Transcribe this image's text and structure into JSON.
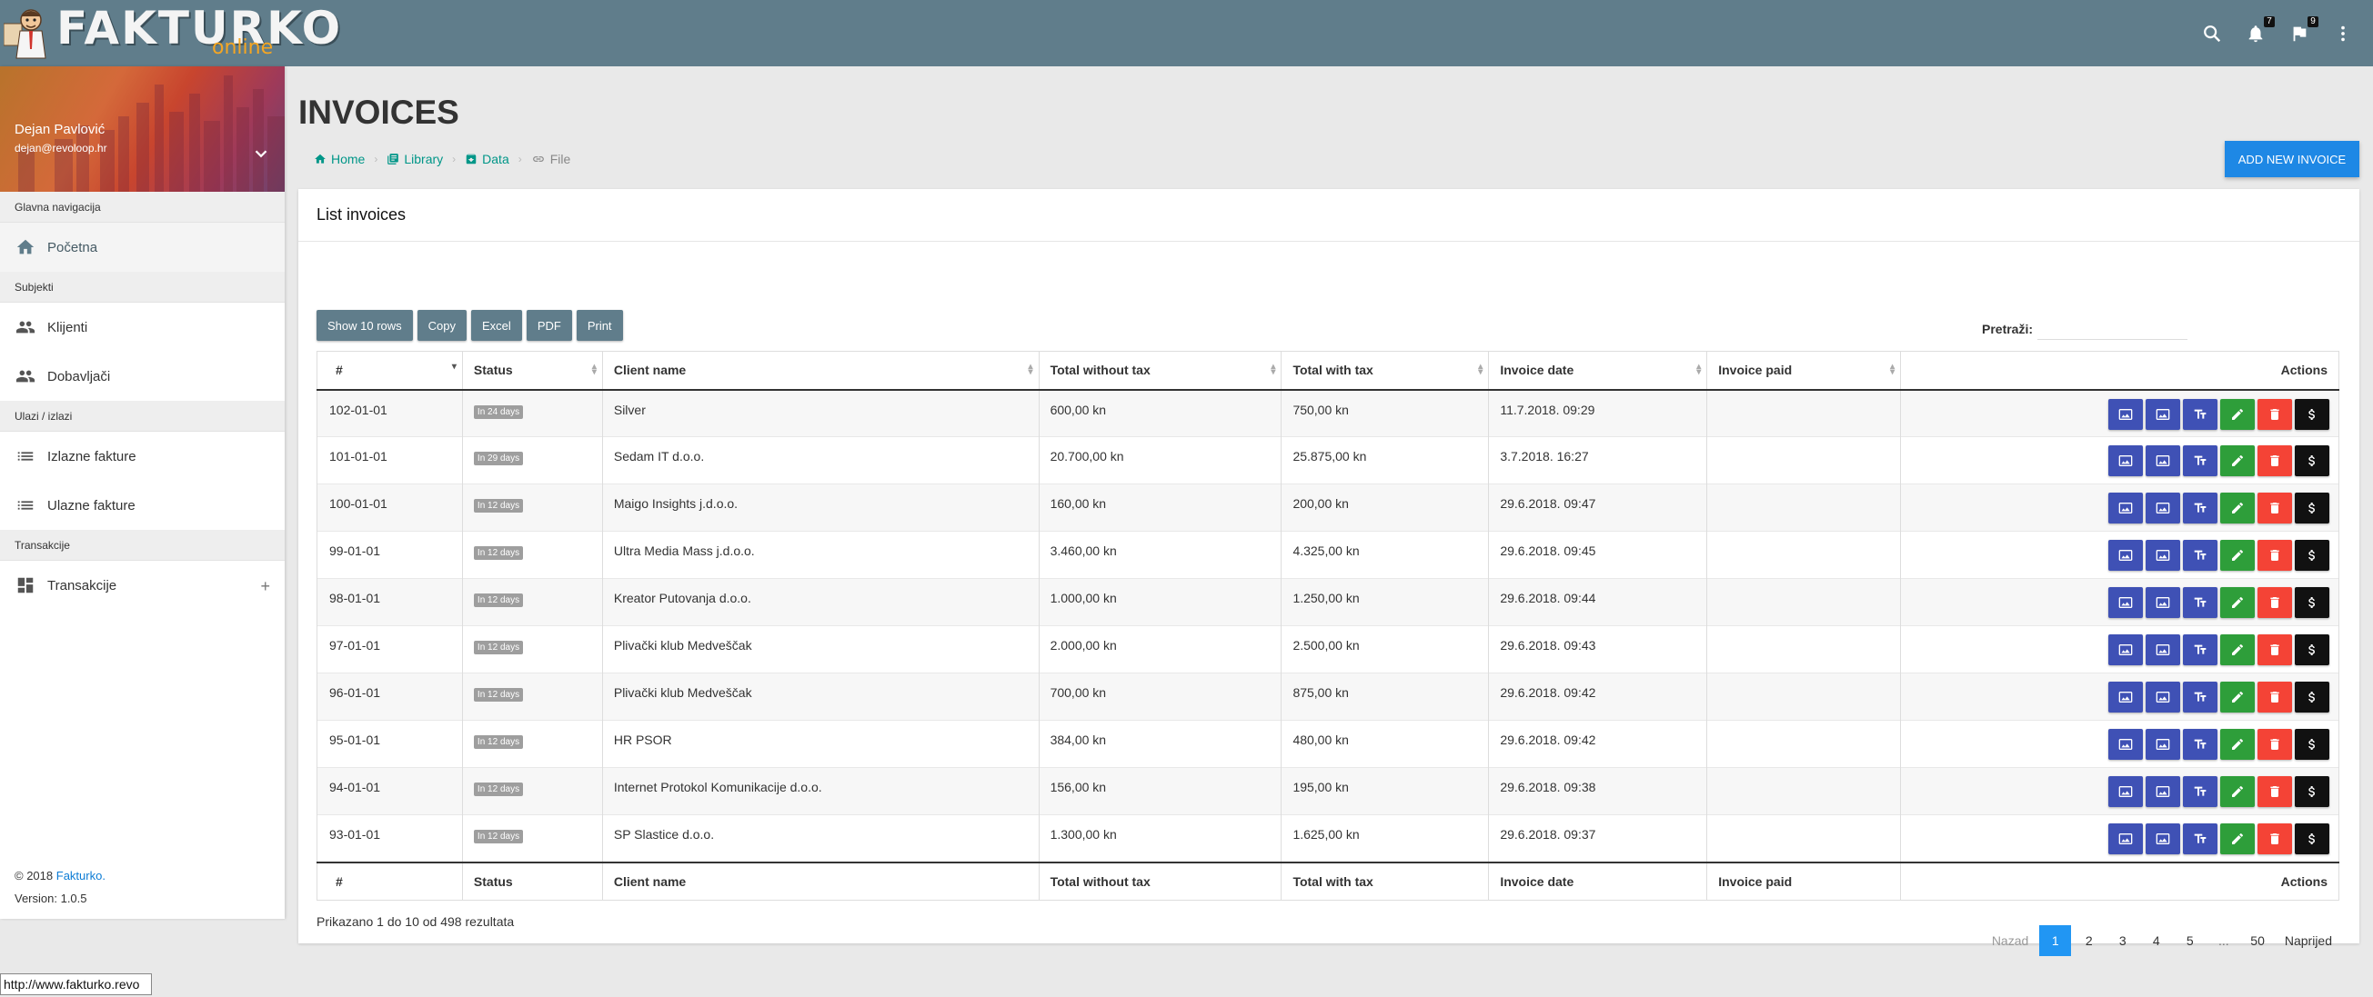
{
  "app": {
    "brand": "FAKTURKO",
    "brand_sub": "online"
  },
  "topbar": {
    "notifications_count": "7",
    "flags_count": "9"
  },
  "user": {
    "name": "Dejan Pavlović",
    "email": "dejan@revoloop.hr"
  },
  "sidebar": {
    "sections": [
      {
        "header": "Glavna navigacija",
        "items": [
          {
            "label": "Početna",
            "icon": "home-icon"
          }
        ]
      },
      {
        "header": "Subjekti",
        "items": [
          {
            "label": "Klijenti",
            "icon": "people-icon"
          },
          {
            "label": "Dobavljači",
            "icon": "people-icon"
          }
        ]
      },
      {
        "header": "Ulazi / izlazi",
        "items": [
          {
            "label": "Izlazne fakture",
            "icon": "list-icon"
          },
          {
            "label": "Ulazne fakture",
            "icon": "list-icon"
          }
        ]
      },
      {
        "header": "Transakcije",
        "items": [
          {
            "label": "Transakcije",
            "icon": "dashboard-icon"
          }
        ]
      }
    ],
    "footer": {
      "copyright_prefix": "© 2018",
      "copyright_link": "Fakturko.",
      "version": "Version: 1.0.5"
    }
  },
  "page": {
    "title": "INVOICES",
    "add_button": "ADD NEW INVOICE",
    "breadcrumb": [
      "Home",
      "Library",
      "Data",
      "File"
    ]
  },
  "card": {
    "title": "List invoices",
    "buttons": [
      "Show 10 rows",
      "Copy",
      "Excel",
      "PDF",
      "Print"
    ],
    "search_label": "Pretraži:",
    "search_value": ""
  },
  "table": {
    "columns": [
      "#",
      "Status",
      "Client name",
      "Total without tax",
      "Total with tax",
      "Invoice date",
      "Invoice paid",
      "Actions"
    ],
    "rows": [
      {
        "id": "102-01-01",
        "status": "In 24 days",
        "client": "Silver",
        "net": "600,00 kn",
        "gross": "750,00 kn",
        "date": "11.7.2018. 09:29",
        "paid": ""
      },
      {
        "id": "101-01-01",
        "status": "In 29 days",
        "client": "Sedam IT d.o.o.",
        "net": "20.700,00 kn",
        "gross": "25.875,00 kn",
        "date": "3.7.2018. 16:27",
        "paid": ""
      },
      {
        "id": "100-01-01",
        "status": "In 12 days",
        "client": "Maigo Insights j.d.o.o.",
        "net": "160,00 kn",
        "gross": "200,00 kn",
        "date": "29.6.2018. 09:47",
        "paid": ""
      },
      {
        "id": "99-01-01",
        "status": "In 12 days",
        "client": "Ultra Media Mass j.d.o.o.",
        "net": "3.460,00 kn",
        "gross": "4.325,00 kn",
        "date": "29.6.2018. 09:45",
        "paid": ""
      },
      {
        "id": "98-01-01",
        "status": "In 12 days",
        "client": "Kreator Putovanja d.o.o.",
        "net": "1.000,00 kn",
        "gross": "1.250,00 kn",
        "date": "29.6.2018. 09:44",
        "paid": ""
      },
      {
        "id": "97-01-01",
        "status": "In 12 days",
        "client": "Plivački klub Medveščak",
        "net": "2.000,00 kn",
        "gross": "2.500,00 kn",
        "date": "29.6.2018. 09:43",
        "paid": ""
      },
      {
        "id": "96-01-01",
        "status": "In 12 days",
        "client": "Plivački klub Medveščak",
        "net": "700,00 kn",
        "gross": "875,00 kn",
        "date": "29.6.2018. 09:42",
        "paid": ""
      },
      {
        "id": "95-01-01",
        "status": "In 12 days",
        "client": "HR PSOR",
        "net": "384,00 kn",
        "gross": "480,00 kn",
        "date": "29.6.2018. 09:42",
        "paid": ""
      },
      {
        "id": "94-01-01",
        "status": "In 12 days",
        "client": "Internet Protokol Komunikacije d.o.o.",
        "net": "156,00 kn",
        "gross": "195,00 kn",
        "date": "29.6.2018. 09:38",
        "paid": ""
      },
      {
        "id": "93-01-01",
        "status": "In 12 days",
        "client": "SP Slastice d.o.o.",
        "net": "1.300,00 kn",
        "gross": "1.625,00 kn",
        "date": "29.6.2018. 09:37",
        "paid": ""
      }
    ],
    "row_actions": [
      {
        "name": "view-invoice-button",
        "icon": "image-icon",
        "color": "#3f51b5"
      },
      {
        "name": "view-invoice-copy-button",
        "icon": "image-icon",
        "color": "#3f51b5"
      },
      {
        "name": "text-button",
        "icon": "text-fields-icon",
        "color": "#3f51b5"
      },
      {
        "name": "edit-button",
        "icon": "pencil-icon",
        "color": "#2e9e3a"
      },
      {
        "name": "delete-button",
        "icon": "trash-icon",
        "color": "#f44336"
      },
      {
        "name": "payment-button",
        "icon": "dollar-icon",
        "color": "#111111"
      }
    ]
  },
  "footer_info": "Prikazano 1 do 10 od 498 rezultata",
  "pagination": {
    "prev": "Nazad",
    "next": "Naprijed",
    "pages": [
      "1",
      "2",
      "3",
      "4",
      "5",
      "...",
      "50"
    ],
    "active": "1"
  },
  "status_bar_url": "http://www.fakturko.revo"
}
